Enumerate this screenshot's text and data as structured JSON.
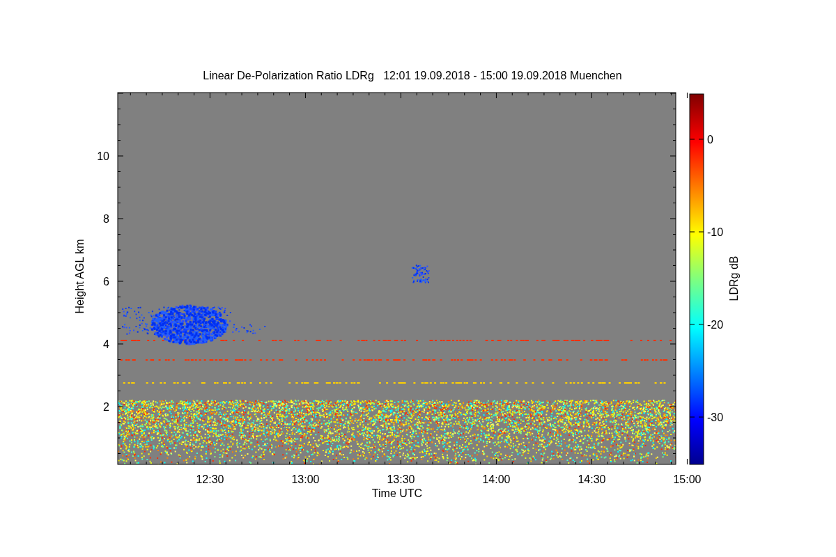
{
  "title": "Linear De-Polarization Ratio LDRg   12:01 19.09.2018 - 15:00 19.09.2018 Muenchen",
  "xlabel": "Time UTC",
  "ylabel": "Height AGL km",
  "xtick_labels": [
    "12:30",
    "13:00",
    "13:30",
    "14:00",
    "14:30",
    "15:00"
  ],
  "ytick_labels": [
    "10",
    "8",
    "6",
    "4",
    "2"
  ],
  "colorbar": {
    "label": "LDRg dB",
    "tick_labels": [
      "0",
      "-10",
      "-20",
      "-30"
    ]
  }
}
